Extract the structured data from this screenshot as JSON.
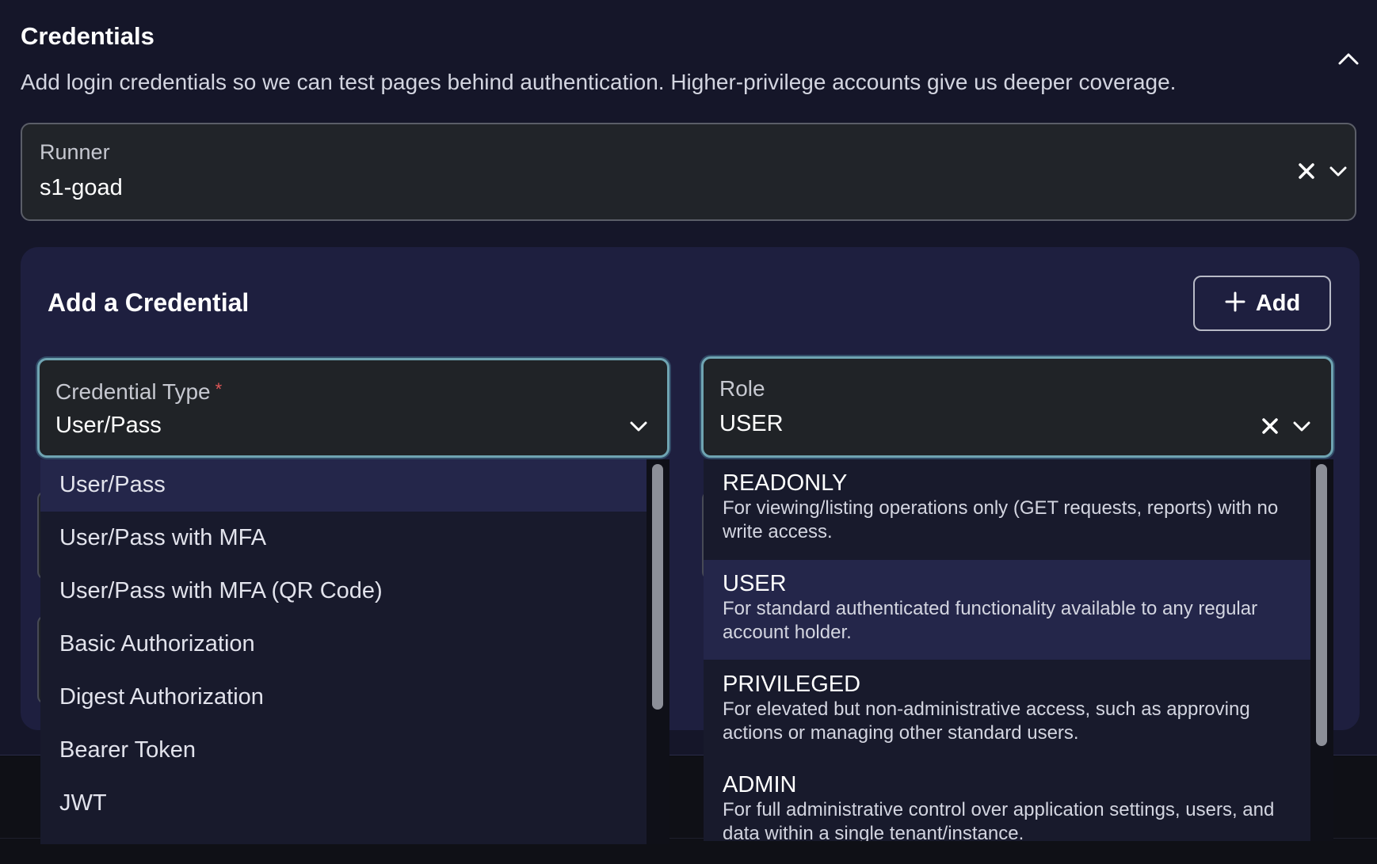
{
  "credentials": {
    "title": "Credentials",
    "description": "Add login credentials so we can test pages behind authentication. Higher-privilege accounts give us deeper coverage."
  },
  "runner": {
    "label": "Runner",
    "value": "s1-goad"
  },
  "add_credential": {
    "title": "Add a Credential",
    "add_button_label": "Add"
  },
  "credential_type": {
    "label": "Credential Type",
    "required_marker": "*",
    "value": "User/Pass",
    "options": [
      "User/Pass",
      "User/Pass with MFA",
      "User/Pass with MFA (QR Code)",
      "Basic Authorization",
      "Digest Authorization",
      "Bearer Token",
      "JWT"
    ]
  },
  "role": {
    "label": "Role",
    "value": "USER",
    "options": [
      {
        "title": "READONLY",
        "description": "For viewing/listing operations only (GET requests, reports) with no write access."
      },
      {
        "title": "USER",
        "description": "For standard authenticated functionality available to any regular account holder."
      },
      {
        "title": "PRIVILEGED",
        "description": "For elevated but non-administrative access, such as approving actions or managing other standard users."
      },
      {
        "title": "ADMIN",
        "description": "For full administrative control over application settings, users, and data within a single tenant/instance."
      }
    ]
  }
}
